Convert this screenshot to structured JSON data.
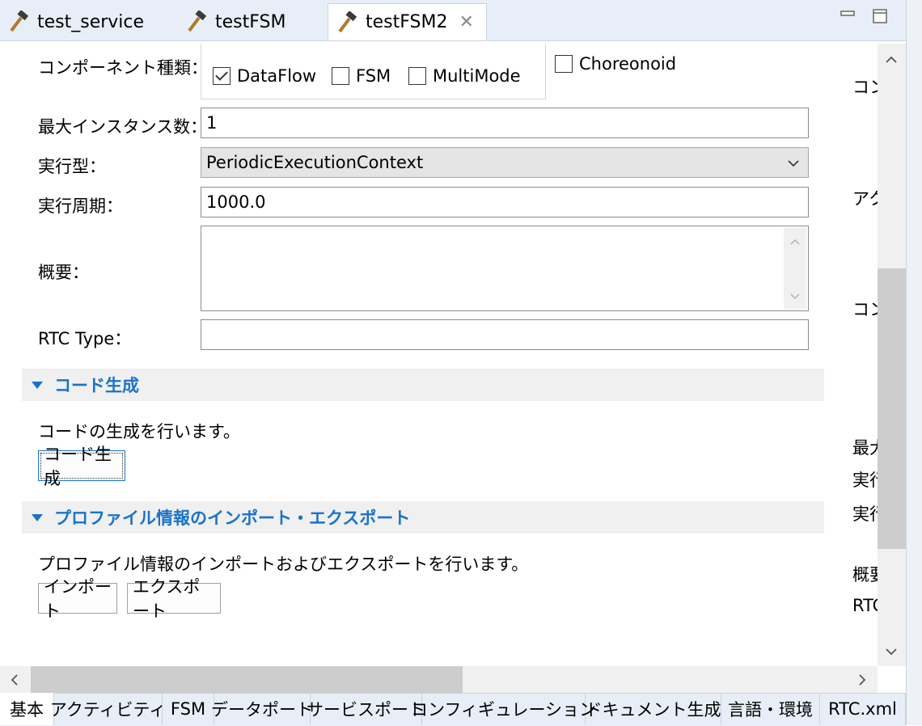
{
  "editor_tabs": [
    {
      "label": "test_service",
      "icon": "hammer-icon"
    },
    {
      "label": "testFSM",
      "icon": "hammer-icon"
    },
    {
      "label": "testFSM2",
      "icon": "hammer-icon",
      "active": true
    }
  ],
  "form": {
    "component_type_label": "コンポーネント種類：",
    "types": [
      {
        "label": "DataFlow",
        "checked": true
      },
      {
        "label": "FSM",
        "checked": false
      },
      {
        "label": "MultiMode",
        "checked": false
      },
      {
        "label": "Choreonoid",
        "checked": false
      }
    ],
    "max_instances_label": "最大インスタンス数：",
    "max_instances_value": "1",
    "exec_type_label": "実行型：",
    "exec_type_value": "PeriodicExecutionContext",
    "exec_rate_label": "実行周期：",
    "exec_rate_value": "1000.0",
    "description_label": "概要：",
    "description_value": "",
    "rtc_type_label": "RTC Type：",
    "rtc_type_value": ""
  },
  "codegen": {
    "title": "コード生成",
    "description": "コードの生成を行います。",
    "button": "コード生成"
  },
  "profile": {
    "title": "プロファイル情報のインポート・エクスポート",
    "description": "プロファイル情報のインポートおよびエクスポートを行います。",
    "import_button": "インポート",
    "export_button": "エクスポート"
  },
  "right_cutoff": [
    "コン",
    "アク",
    "コン",
    "最大",
    "実行",
    "実行",
    "概要",
    "RTC"
  ],
  "bottom_tabs": [
    "基本",
    "アクティビティ",
    "FSM",
    "データポート",
    "サービスポート",
    "コンフィギュレーション",
    "ドキュメント生成",
    "言語・環境",
    "RTC.xml"
  ],
  "colors": {
    "accent": "#1a73c8",
    "tab_bg": "#e8eef7",
    "section_bg": "#f0f0f0"
  }
}
